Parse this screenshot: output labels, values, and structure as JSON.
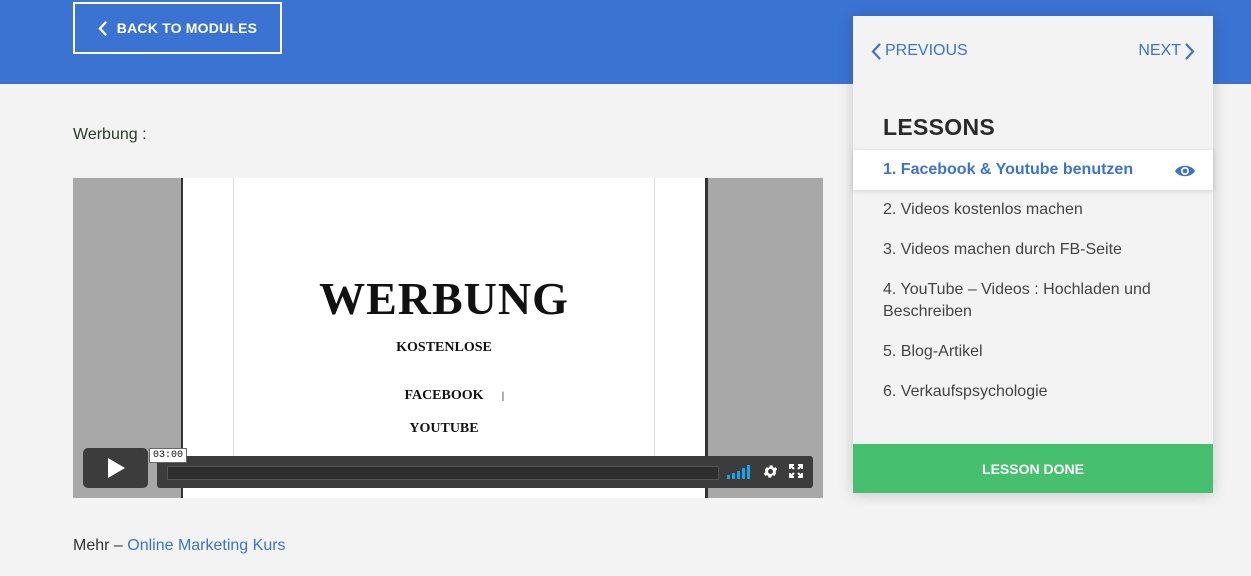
{
  "header": {
    "back_label": "BACK TO MODULES",
    "back_icon": "chevron-left-icon",
    "bg_color": "#3b73d3"
  },
  "content": {
    "intro": "Werbung :",
    "video": {
      "slide_title": "WERBUNG",
      "slide_lines": [
        "KOSTENLOSE",
        "FACEBOOK",
        "YOUTUBE"
      ],
      "time_tooltip": "03:00"
    },
    "more_prefix": "Mehr – ",
    "more_link": "Online Marketing Kurs"
  },
  "panel": {
    "prev_label": "PREVIOUS",
    "next_label": "NEXT",
    "heading": "LESSONS",
    "lessons": [
      {
        "label": "1. Facebook & Youtube benutzen",
        "active": true,
        "icon": "eye-icon"
      },
      {
        "label": "2. Videos kostenlos machen"
      },
      {
        "label": "3. Videos machen durch FB-Seite"
      },
      {
        "label": "4. YouTube – Videos : Hochladen und Beschreiben"
      },
      {
        "label": "5. Blog-Artikel"
      },
      {
        "label": "6. Verkaufspsychologie"
      }
    ],
    "done_label": "LESSON DONE",
    "done_color": "#46bf6f"
  }
}
